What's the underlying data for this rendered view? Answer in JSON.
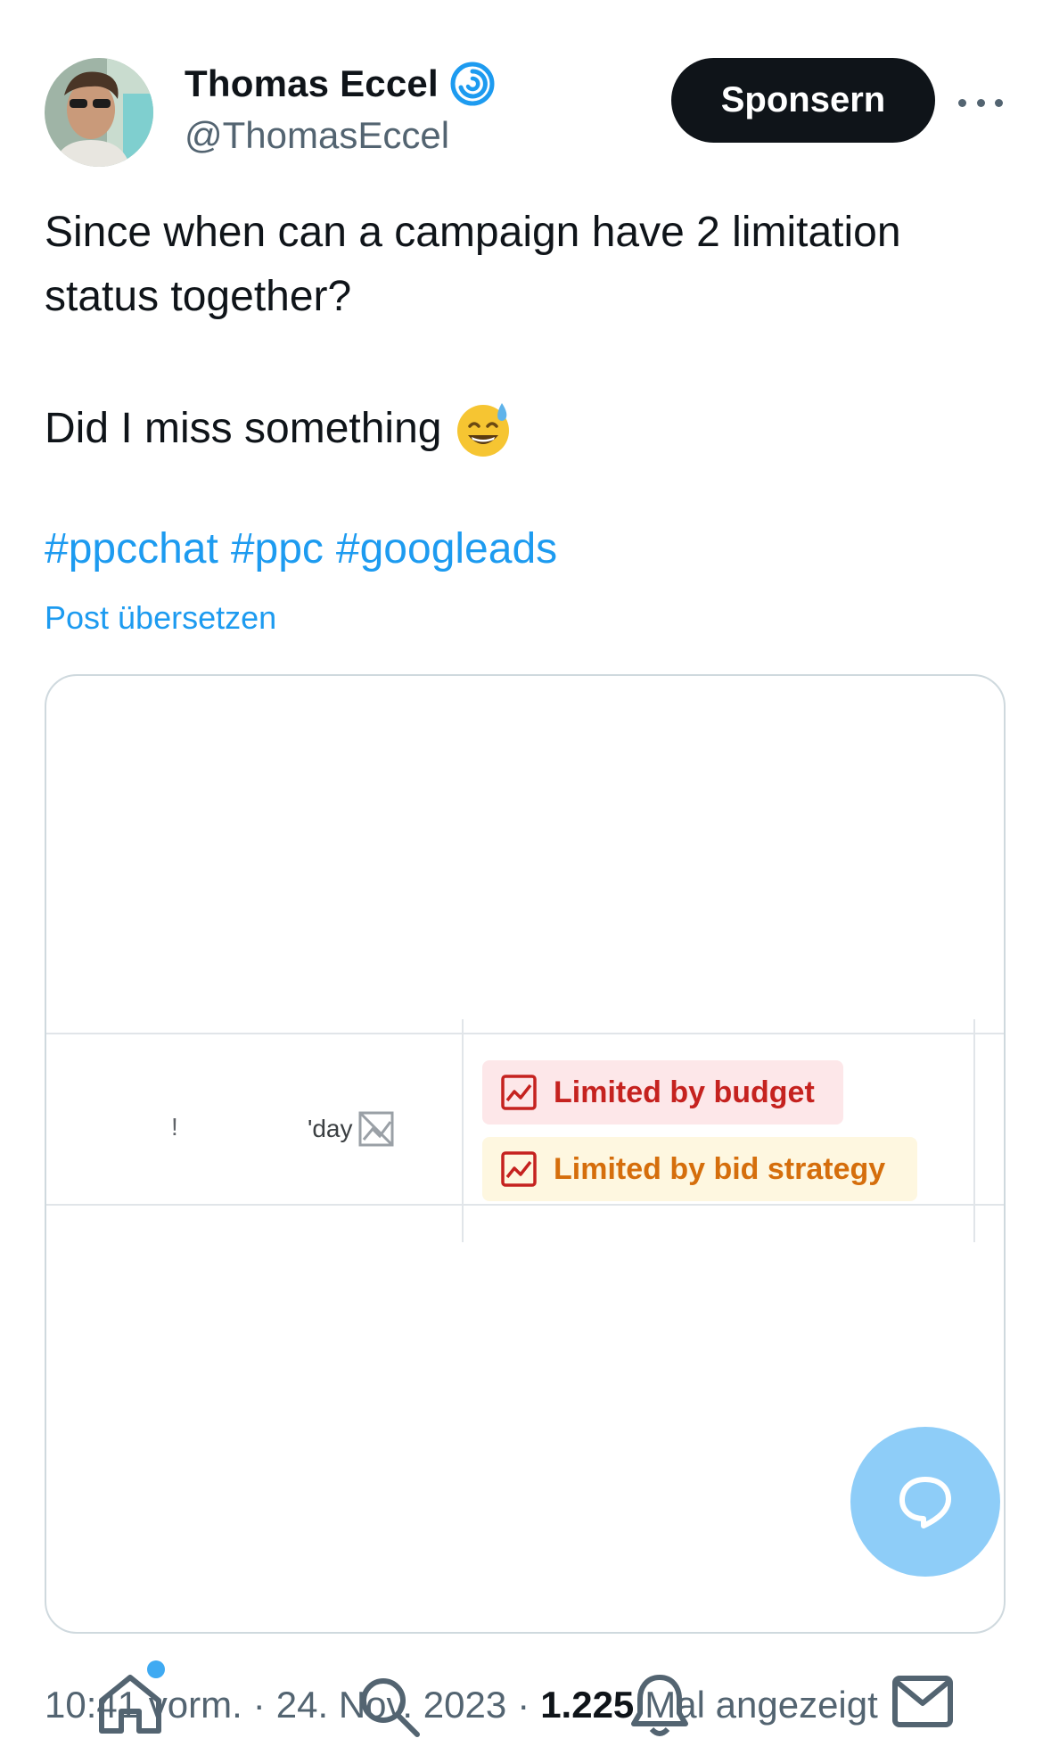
{
  "author": {
    "display_name": "Thomas Eccel",
    "handle": "@ThomasEccel"
  },
  "header": {
    "sponsor_label": "Sponsern",
    "more_icon": "more-horizontal-icon"
  },
  "tweet": {
    "line1": "Since when can a campaign have 2 limitation status together?",
    "line2": "Did I miss something",
    "emoji": "sweat-smile-emoji",
    "hashtags": [
      "#ppcchat",
      "#ppc",
      "#googleads"
    ],
    "translate_label": "Post übersetzen"
  },
  "media": {
    "cell_fragment_1": "!",
    "cell_fragment_2": "'day",
    "status_chips": [
      {
        "label": "Limited by budget",
        "color": "#c5221f",
        "bg": "#fde7e9"
      },
      {
        "label": "Limited by bid strategy",
        "color": "#d56e0c",
        "bg": "#fef7e0"
      }
    ]
  },
  "footer": {
    "time": "10:41 vorm.",
    "date": "24. Nov. 2023",
    "views_count": "1.225",
    "views_label": "Mal angezeigt"
  },
  "colors": {
    "link": "#1d9bf0",
    "text": "#0f1419",
    "muted": "#536471",
    "fab": "#8ecdf8"
  }
}
